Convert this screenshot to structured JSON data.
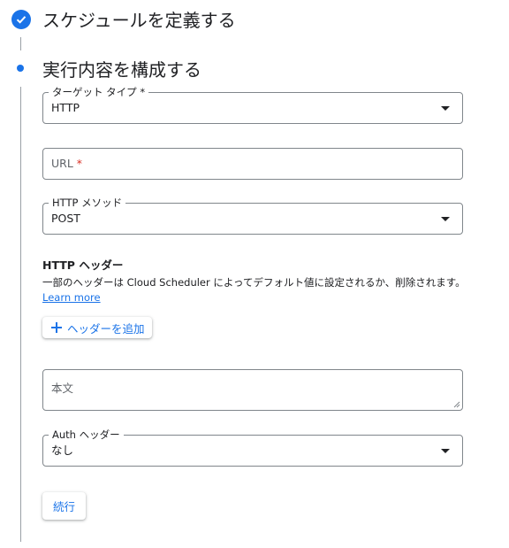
{
  "steps": {
    "schedule_title": "スケジュールを定義する",
    "execution_title": "実行内容を構成する"
  },
  "form": {
    "target_type": {
      "label": "ターゲット タイプ",
      "required_mark": "*",
      "value": "HTTP"
    },
    "url": {
      "label": "URL",
      "required_mark": "*"
    },
    "http_method": {
      "label": "HTTP メソッド",
      "value": "POST"
    },
    "http_headers": {
      "heading": "HTTP ヘッダー",
      "description": "一部のヘッダーは Cloud Scheduler によってデフォルト値に設定されるか、削除されます。",
      "learn_more": "Learn more",
      "add_button": "ヘッダーを追加"
    },
    "body": {
      "placeholder": "本文"
    },
    "auth_header": {
      "label": "Auth ヘッダー",
      "value": "なし"
    },
    "continue_button": "続行"
  },
  "colors": {
    "accent": "#1a73e8",
    "required": "#d93025",
    "border": "#80868b"
  }
}
